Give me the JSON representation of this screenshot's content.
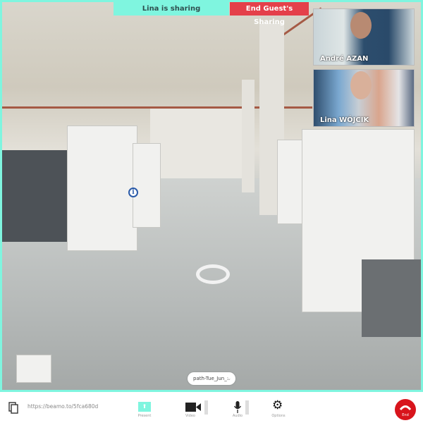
{
  "banner": {
    "sharing": "Lina is sharing",
    "end_sharing": "End Guest's Sharing"
  },
  "participants": [
    {
      "name": "André AZAN"
    },
    {
      "name": "Lina WÓJCIK"
    }
  ],
  "scene": {
    "path_selector": "path-Tue_Jun_:"
  },
  "toolbar": {
    "url": "https://beamo.to/5fca680d",
    "present": "Present",
    "video": "Video",
    "audio": "Audio",
    "options": "Options",
    "end": "End"
  },
  "colors": {
    "accent": "#7ff5df",
    "danger": "#e4404a",
    "end_call": "#d8141c"
  }
}
